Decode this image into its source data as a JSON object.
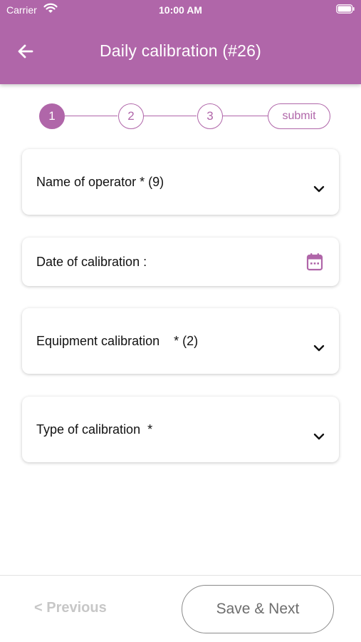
{
  "status_bar": {
    "carrier": "Carrier",
    "time": "10:00 AM"
  },
  "header": {
    "title": "Daily calibration (#26)"
  },
  "stepper": {
    "steps": [
      "1",
      "2",
      "3"
    ],
    "submit_label": "submit",
    "active_step": 1
  },
  "fields": [
    {
      "label": "Name of operator * (9)",
      "icon": "chevron-down-icon"
    },
    {
      "label": "Date of calibration :",
      "icon": "calendar-icon"
    },
    {
      "label": "Equipment calibration    * (2)",
      "icon": "chevron-down-icon"
    },
    {
      "label": "Type of calibration  *",
      "icon": "chevron-down-icon"
    }
  ],
  "footer": {
    "previous_label": "< Previous",
    "next_label": "Save & Next"
  },
  "colors": {
    "accent": "#b066a9",
    "disabled_text": "#c7c7c7",
    "button_border": "#8a8a8a"
  }
}
